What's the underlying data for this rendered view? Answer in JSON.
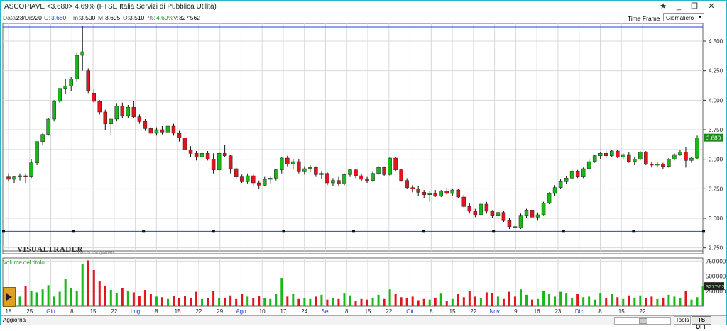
{
  "window": {
    "title": "ASCOPIAVE <3.680> 4.69%  (FTSE Italia Servizi di Pubblica Utilità)",
    "buttons": [
      "star-icon",
      "minimize-icon",
      "restore-icon",
      "close-icon"
    ]
  },
  "infobar": {
    "date_label": "Data:",
    "date_value": "23/Dic/20",
    "c_label": "C:",
    "c_value": "3.680",
    "m_label": "m:",
    "m_value": "3.500",
    "M_label": "M:",
    "M_value": "3.695",
    "o_label": "O:",
    "o_value": "3.510",
    "pct_label": "%:",
    "pct_value": "4.69%",
    "v_label": "V:",
    "v_value": "327'562"
  },
  "timeframe": {
    "label": "Time Frame",
    "selected": "Giornaliero"
  },
  "branding": {
    "logo": "VISUALTRADER",
    "sub": "Dati di fine giornata"
  },
  "volume_panel": {
    "label": "Volume del titolo"
  },
  "statusbar": {
    "aggiorna": "Aggiorna",
    "tools": "Tools",
    "ts_off": "TS OFF"
  },
  "colors": {
    "up": "#18b818",
    "down": "#e0151e",
    "hline": "#2a3fd6",
    "grid": "#d8d8d8",
    "last_price_bg": "#1a8a1a"
  },
  "chart_data": [
    {
      "type": "candlestick",
      "title": "ASCOPIAVE",
      "ylim": [
        2.7,
        4.65
      ],
      "y_ticks": [
        "4.500",
        "4.250",
        "4.000",
        "3.750",
        "3.500",
        "3.250",
        "3.000",
        "2.750"
      ],
      "last_price_label": "3.680",
      "horizontal_lines": [
        3.58,
        2.89,
        4.62
      ],
      "x_tick_labels": [
        "18",
        "25",
        "Giu",
        "8",
        "15",
        "22",
        "Lug",
        "8",
        "15",
        "22",
        "29",
        "Ago",
        "10",
        "17",
        "24",
        "Set",
        "8",
        "15",
        "22",
        "Ott",
        "8",
        "15",
        "22",
        "Nov",
        "9",
        "16",
        "23",
        "Dic",
        "8",
        "15",
        "22"
      ],
      "month_labels": [
        "Giu",
        "Lug",
        "Ago",
        "Set",
        "Ott",
        "Nov",
        "Dic"
      ],
      "candles": [
        [
          3.35,
          3.38,
          3.31,
          3.33
        ],
        [
          3.33,
          3.36,
          3.3,
          3.35
        ],
        [
          3.35,
          3.38,
          3.32,
          3.36
        ],
        [
          3.36,
          3.38,
          3.3,
          3.35
        ],
        [
          3.35,
          3.5,
          3.34,
          3.47
        ],
        [
          3.47,
          3.65,
          3.45,
          3.65
        ],
        [
          3.65,
          3.72,
          3.62,
          3.71
        ],
        [
          3.71,
          3.85,
          3.7,
          3.84
        ],
        [
          3.84,
          4.0,
          3.82,
          3.99
        ],
        [
          3.99,
          4.1,
          3.98,
          4.1
        ],
        [
          4.1,
          4.18,
          4.05,
          4.12
        ],
        [
          4.12,
          4.2,
          4.08,
          4.18
        ],
        [
          4.18,
          4.4,
          4.16,
          4.38
        ],
        [
          4.38,
          4.63,
          4.25,
          4.41
        ],
        [
          4.25,
          4.27,
          4.06,
          4.08
        ],
        [
          4.06,
          4.09,
          3.98,
          3.99
        ],
        [
          3.99,
          4.0,
          3.88,
          3.9
        ],
        [
          3.9,
          3.92,
          3.75,
          3.8
        ],
        [
          3.8,
          3.85,
          3.7,
          3.84
        ],
        [
          3.84,
          3.97,
          3.82,
          3.95
        ],
        [
          3.95,
          3.98,
          3.85,
          3.87
        ],
        [
          3.87,
          3.96,
          3.85,
          3.94
        ],
        [
          3.94,
          3.99,
          3.85,
          3.86
        ],
        [
          3.86,
          3.88,
          3.8,
          3.82
        ],
        [
          3.82,
          3.84,
          3.74,
          3.76
        ],
        [
          3.76,
          3.78,
          3.7,
          3.72
        ],
        [
          3.72,
          3.77,
          3.7,
          3.75
        ],
        [
          3.75,
          3.78,
          3.71,
          3.73
        ],
        [
          3.73,
          3.81,
          3.7,
          3.78
        ],
        [
          3.78,
          3.8,
          3.7,
          3.72
        ],
        [
          3.72,
          3.74,
          3.65,
          3.68
        ],
        [
          3.68,
          3.7,
          3.56,
          3.58
        ],
        [
          3.58,
          3.61,
          3.52,
          3.55
        ],
        [
          3.55,
          3.57,
          3.49,
          3.52
        ],
        [
          3.52,
          3.56,
          3.49,
          3.55
        ],
        [
          3.55,
          3.57,
          3.49,
          3.5
        ],
        [
          3.5,
          3.55,
          3.38,
          3.41
        ],
        [
          3.41,
          3.56,
          3.4,
          3.55
        ],
        [
          3.55,
          3.62,
          3.52,
          3.53
        ],
        [
          3.53,
          3.54,
          3.38,
          3.42
        ],
        [
          3.42,
          3.43,
          3.33,
          3.35
        ],
        [
          3.35,
          3.37,
          3.3,
          3.31
        ],
        [
          3.31,
          3.38,
          3.29,
          3.36
        ],
        [
          3.36,
          3.38,
          3.28,
          3.3
        ],
        [
          3.3,
          3.32,
          3.25,
          3.28
        ],
        [
          3.28,
          3.35,
          3.27,
          3.33
        ],
        [
          3.33,
          3.36,
          3.29,
          3.34
        ],
        [
          3.34,
          3.42,
          3.32,
          3.41
        ],
        [
          3.41,
          3.52,
          3.38,
          3.51
        ],
        [
          3.51,
          3.53,
          3.44,
          3.46
        ],
        [
          3.46,
          3.5,
          3.42,
          3.48
        ],
        [
          3.48,
          3.5,
          3.38,
          3.4
        ],
        [
          3.4,
          3.44,
          3.37,
          3.42
        ],
        [
          3.42,
          3.45,
          3.39,
          3.43
        ],
        [
          3.43,
          3.44,
          3.35,
          3.37
        ],
        [
          3.37,
          3.4,
          3.33,
          3.38
        ],
        [
          3.38,
          3.39,
          3.28,
          3.3
        ],
        [
          3.3,
          3.34,
          3.27,
          3.32
        ],
        [
          3.32,
          3.35,
          3.27,
          3.29
        ],
        [
          3.29,
          3.38,
          3.28,
          3.37
        ],
        [
          3.37,
          3.42,
          3.35,
          3.41
        ],
        [
          3.41,
          3.42,
          3.34,
          3.36
        ],
        [
          3.36,
          3.38,
          3.31,
          3.33
        ],
        [
          3.33,
          3.35,
          3.3,
          3.32
        ],
        [
          3.32,
          3.4,
          3.31,
          3.38
        ],
        [
          3.38,
          3.44,
          3.37,
          3.43
        ],
        [
          3.43,
          3.44,
          3.36,
          3.37
        ],
        [
          3.37,
          3.52,
          3.36,
          3.51
        ],
        [
          3.51,
          3.52,
          3.4,
          3.41
        ],
        [
          3.41,
          3.42,
          3.31,
          3.32
        ],
        [
          3.32,
          3.34,
          3.25,
          3.26
        ],
        [
          3.26,
          3.28,
          3.22,
          3.25
        ],
        [
          3.25,
          3.27,
          3.19,
          3.22
        ],
        [
          3.22,
          3.24,
          3.17,
          3.2
        ],
        [
          3.2,
          3.23,
          3.14,
          3.21
        ],
        [
          3.21,
          3.24,
          3.18,
          3.19
        ],
        [
          3.19,
          3.24,
          3.18,
          3.23
        ],
        [
          3.23,
          3.26,
          3.2,
          3.21
        ],
        [
          3.21,
          3.25,
          3.19,
          3.24
        ],
        [
          3.24,
          3.25,
          3.17,
          3.18
        ],
        [
          3.18,
          3.2,
          3.09,
          3.1
        ],
        [
          3.1,
          3.13,
          3.04,
          3.06
        ],
        [
          3.06,
          3.08,
          3.01,
          3.03
        ],
        [
          3.03,
          3.14,
          3.02,
          3.12
        ],
        [
          3.12,
          3.14,
          3.04,
          3.06
        ],
        [
          3.06,
          3.07,
          3.0,
          3.02
        ],
        [
          3.02,
          3.06,
          2.99,
          3.05
        ],
        [
          3.05,
          3.06,
          2.97,
          2.98
        ],
        [
          2.98,
          3.0,
          2.91,
          2.93
        ],
        [
          2.93,
          2.96,
          2.9,
          2.92
        ],
        [
          2.92,
          3.04,
          2.91,
          3.02
        ],
        [
          3.02,
          3.08,
          3.0,
          3.07
        ],
        [
          3.07,
          3.08,
          3.0,
          3.01
        ],
        [
          3.01,
          3.05,
          2.98,
          3.03
        ],
        [
          3.03,
          3.14,
          3.02,
          3.13
        ],
        [
          3.13,
          3.22,
          3.12,
          3.21
        ],
        [
          3.21,
          3.28,
          3.19,
          3.26
        ],
        [
          3.26,
          3.33,
          3.25,
          3.31
        ],
        [
          3.31,
          3.36,
          3.29,
          3.34
        ],
        [
          3.34,
          3.42,
          3.33,
          3.4
        ],
        [
          3.4,
          3.41,
          3.34,
          3.35
        ],
        [
          3.35,
          3.43,
          3.34,
          3.42
        ],
        [
          3.42,
          3.5,
          3.41,
          3.48
        ],
        [
          3.48,
          3.54,
          3.47,
          3.53
        ],
        [
          3.53,
          3.56,
          3.5,
          3.55
        ],
        [
          3.55,
          3.57,
          3.51,
          3.53
        ],
        [
          3.53,
          3.58,
          3.52,
          3.57
        ],
        [
          3.57,
          3.58,
          3.51,
          3.52
        ],
        [
          3.52,
          3.55,
          3.5,
          3.54
        ],
        [
          3.54,
          3.56,
          3.47,
          3.48
        ],
        [
          3.48,
          3.52,
          3.45,
          3.5
        ],
        [
          3.5,
          3.57,
          3.49,
          3.56
        ],
        [
          3.56,
          3.57,
          3.45,
          3.46
        ],
        [
          3.46,
          3.48,
          3.43,
          3.45
        ],
        [
          3.45,
          3.48,
          3.43,
          3.46
        ],
        [
          3.46,
          3.47,
          3.42,
          3.44
        ],
        [
          3.44,
          3.51,
          3.43,
          3.5
        ],
        [
          3.5,
          3.55,
          3.49,
          3.54
        ],
        [
          3.54,
          3.58,
          3.53,
          3.56
        ],
        [
          3.56,
          3.6,
          3.43,
          3.49
        ],
        [
          3.49,
          3.52,
          3.47,
          3.51
        ],
        [
          3.51,
          3.7,
          3.5,
          3.68
        ]
      ]
    },
    {
      "type": "bar",
      "title": "Volume del titolo",
      "ylim": [
        0,
        800000
      ],
      "y_ticks": [
        "750'000",
        "500'000",
        "250'000"
      ],
      "last_value_label": "327'562",
      "values": [
        220000,
        180000,
        160000,
        330000,
        260000,
        230000,
        280000,
        350000,
        160000,
        240000,
        450000,
        300000,
        250000,
        700000,
        760000,
        600000,
        420000,
        330000,
        270000,
        220000,
        300000,
        250000,
        230000,
        170000,
        270000,
        200000,
        160000,
        150000,
        120000,
        170000,
        130000,
        170000,
        140000,
        240000,
        120000,
        140000,
        250000,
        140000,
        130000,
        180000,
        120000,
        200000,
        160000,
        130000,
        170000,
        140000,
        120000,
        200000,
        470000,
        160000,
        200000,
        120000,
        140000,
        120000,
        160000,
        190000,
        110000,
        140000,
        120000,
        210000,
        180000,
        90000,
        120000,
        110000,
        130000,
        190000,
        120000,
        280000,
        200000,
        150000,
        140000,
        160000,
        100000,
        120000,
        110000,
        130000,
        210000,
        90000,
        120000,
        200000,
        150000,
        250000,
        160000,
        140000,
        230000,
        220000,
        160000,
        120000,
        240000,
        160000,
        280000,
        190000,
        110000,
        120000,
        260000,
        200000,
        160000,
        240000,
        210000,
        140000,
        200000,
        150000,
        160000,
        110000,
        220000,
        130000,
        200000,
        150000,
        120000,
        180000,
        130000,
        180000,
        140000,
        160000,
        120000,
        130000,
        190000,
        160000,
        140000,
        250000,
        110000,
        150000,
        327562
      ]
    }
  ]
}
